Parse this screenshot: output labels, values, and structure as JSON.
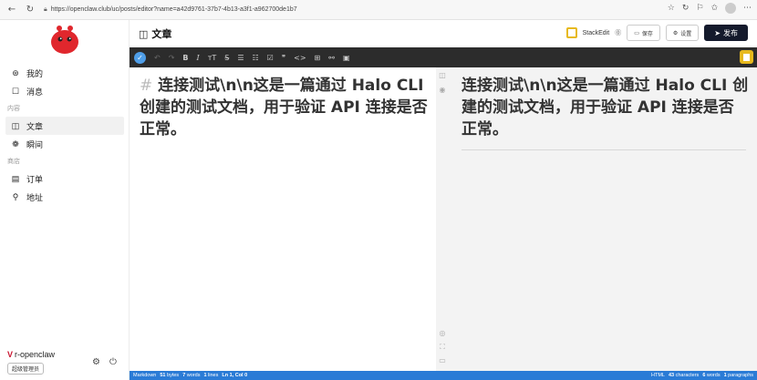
{
  "browser": {
    "url": "https://openclaw.club/uc/posts/editor?name=a42d9761-37b7-4b13-a3f1-a962700de1b7"
  },
  "sidebar": {
    "items_top": [
      {
        "label": "我的",
        "icon": "user-circle-icon"
      },
      {
        "label": "消息",
        "icon": "message-icon"
      }
    ],
    "group_content": "内容",
    "items_content": [
      {
        "label": "文章",
        "icon": "article-icon",
        "active": true
      },
      {
        "label": "瞬间",
        "icon": "moment-icon"
      }
    ],
    "group_shop": "商店",
    "items_shop": [
      {
        "label": "订单",
        "icon": "order-icon"
      },
      {
        "label": "地址",
        "icon": "address-icon"
      }
    ],
    "user": {
      "name": "r-openclaw",
      "role": "超级管理员"
    }
  },
  "header": {
    "title": "文章",
    "stackedit_label": "StackEdit",
    "save_label": "保存",
    "settings_label": "设置",
    "publish_label": "发布"
  },
  "toolbar": {
    "buttons": [
      "↶",
      "↷",
      "B",
      "I",
      "ᴛT",
      "S",
      "☰",
      "☷",
      "☑",
      "❞",
      "<>",
      "⊞",
      "🔗",
      "▣"
    ]
  },
  "editor": {
    "hash": "#",
    "content": " 连接测试\\n\\n这是一篇通过 Halo CLI 创建的测试文档，用于验证 API 连接是否正常。"
  },
  "preview": {
    "content": "连接测试\\n\\n这是一篇通过 Halo CLI 创建的测试文档，用于验证 API 连接是否正常。"
  },
  "status": {
    "left": {
      "mode": "Markdown",
      "bytes": "51",
      "bytes_label": "bytes",
      "words": "7",
      "words_label": "words",
      "lines": "1",
      "lines_label": "lines",
      "position": "Ln 1, Col 0"
    },
    "right": {
      "mode": "HTML",
      "characters": "43",
      "characters_label": "characters",
      "words": "6",
      "words_label": "words",
      "paragraphs": "1",
      "paragraphs_label": "paragraphs"
    }
  },
  "colors": {
    "toolbar_bg": "#2c2c2c",
    "status_bg": "#2a7bd6",
    "publish_bg": "#141a2c",
    "stackedit_accent": "#e7b91d",
    "check_blue": "#4f9ee8"
  }
}
